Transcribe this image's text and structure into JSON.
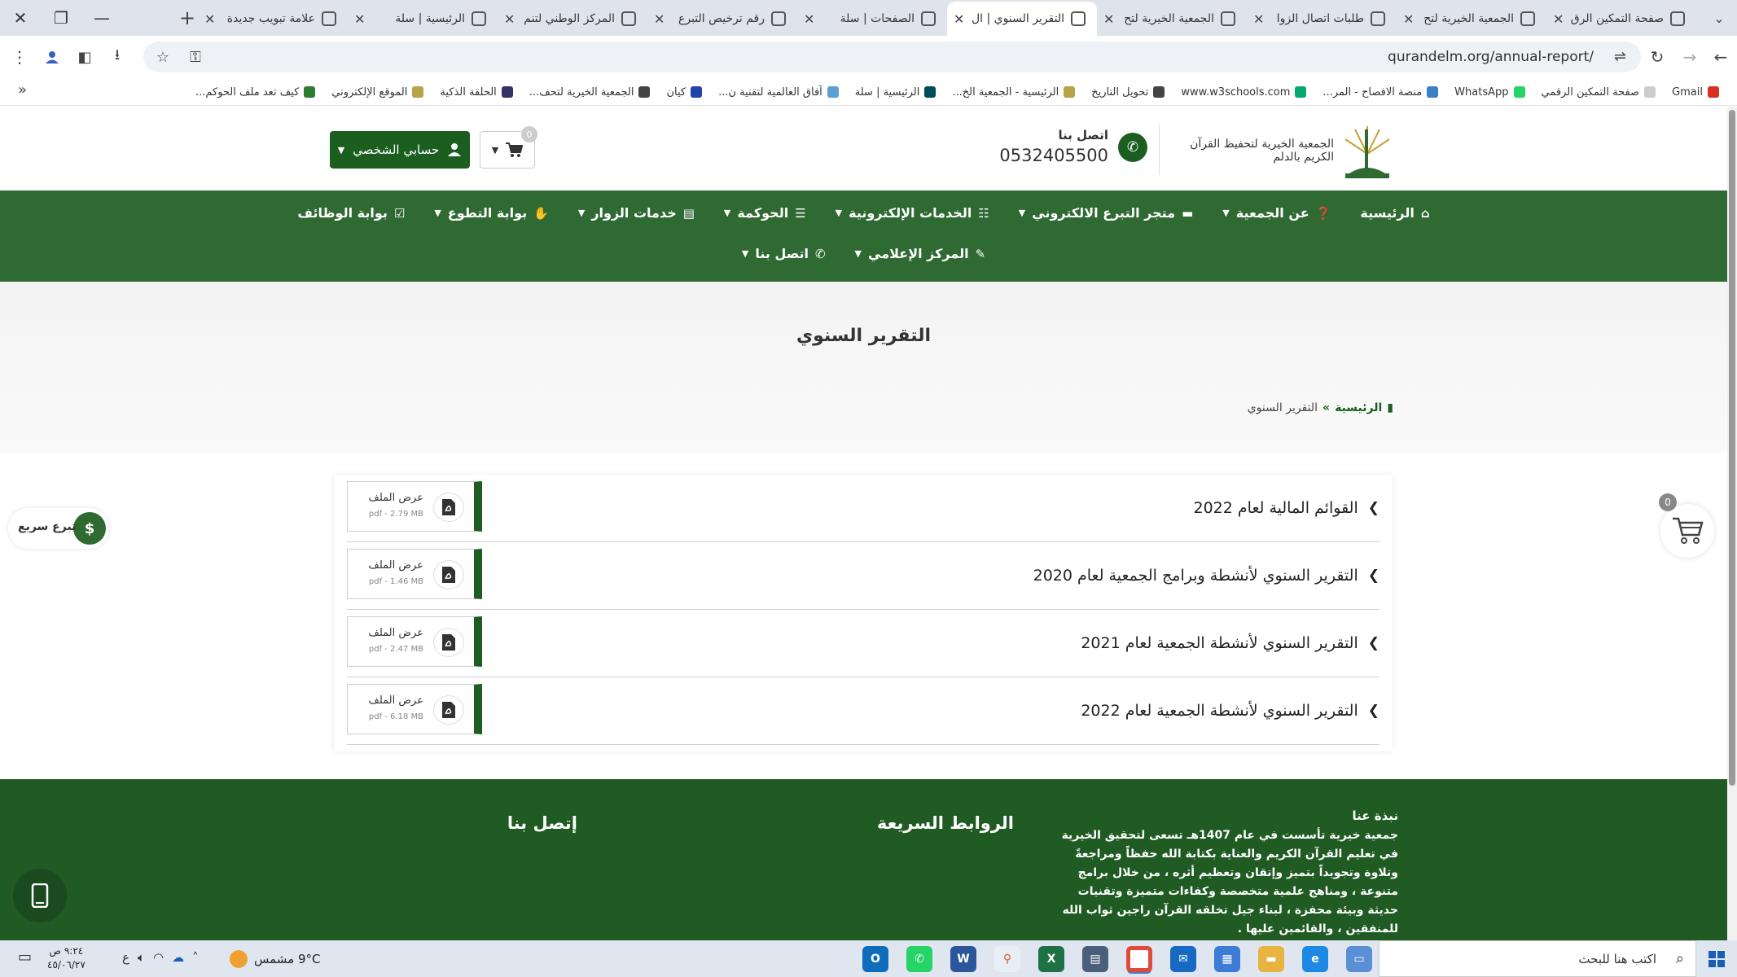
{
  "browser": {
    "tabs": [
      {
        "title": "صفحة التمكين الرق",
        "active": false
      },
      {
        "title": "الجمعية الخيرية لتح",
        "active": false
      },
      {
        "title": "طلبات اتصال الزوا",
        "active": false
      },
      {
        "title": "الجمعية الخيرية لتح",
        "active": false
      },
      {
        "title": "التقرير السنوي | ال",
        "active": true
      },
      {
        "title": "الصفحات | سلة",
        "active": false
      },
      {
        "title": "رقم ترخيص التبرع",
        "active": false
      },
      {
        "title": "المركز الوطني لتنم",
        "active": false
      },
      {
        "title": "الرئيسية | سلة",
        "active": false
      },
      {
        "title": "علامة تبويب جديدة",
        "active": false
      }
    ],
    "url": "qurandelm.org/annual-report/",
    "bookmarks": [
      {
        "label": "Gmail",
        "color": "#d93025"
      },
      {
        "label": "صفحة التمكين الرقمي",
        "color": "#cccccc"
      },
      {
        "label": "WhatsApp",
        "color": "#25d366"
      },
      {
        "label": "منصة الافصاح - المر...",
        "color": "#3b82c4"
      },
      {
        "label": "www.w3schools.com",
        "color": "#04aa6d"
      },
      {
        "label": "تحويل التاريخ",
        "color": "#444444"
      },
      {
        "label": "الرئيسية - الجمعية الخ...",
        "color": "#b8a24a"
      },
      {
        "label": "الرئيسية | سلة",
        "color": "#004d5a"
      },
      {
        "label": "آفاق العالمية لتقنية ن...",
        "color": "#5aa0d8"
      },
      {
        "label": "كيان",
        "color": "#2244aa"
      },
      {
        "label": "الجمعية الخيرية لتحف...",
        "color": "#444444"
      },
      {
        "label": "الحلقة الذكية",
        "color": "#333366"
      },
      {
        "label": "الموقع الإلكتروني",
        "color": "#b8a24a"
      },
      {
        "label": "كيف تعد ملف الحوكم...",
        "color": "#2e7d32"
      }
    ]
  },
  "site": {
    "contact_label": "اتصل بنا",
    "phone": "0532405500",
    "account_label": "حسابي الشخصي",
    "cart_count": "0",
    "logo_text": "الجمعية الخيرية لتحفيظ القرآن الكريم بالدلم",
    "nav_row1": [
      {
        "label": "الرئيسية",
        "icon": "⌂",
        "caret": false,
        "name": "home"
      },
      {
        "label": "عن الجمعية",
        "icon": "❓",
        "caret": true,
        "name": "about"
      },
      {
        "label": "متجر التبرع الالكتروني",
        "icon": "▬",
        "caret": true,
        "name": "donation-store"
      },
      {
        "label": "الخدمات الإلكترونية",
        "icon": "☷",
        "caret": true,
        "name": "e-services"
      },
      {
        "label": "الحوكمة",
        "icon": "☰",
        "caret": true,
        "name": "governance"
      },
      {
        "label": "خدمات الزوار",
        "icon": "▤",
        "caret": true,
        "name": "visitor-services"
      },
      {
        "label": "بوابة التطوع",
        "icon": "✋",
        "caret": true,
        "name": "volunteer-portal"
      },
      {
        "label": "بوابة الوظائف",
        "icon": "☑",
        "caret": false,
        "name": "jobs-portal"
      }
    ],
    "nav_row2": [
      {
        "label": "المركز الإعلامي",
        "icon": "✎",
        "caret": true,
        "name": "media-center"
      },
      {
        "label": "اتصل بنا",
        "icon": "✆",
        "caret": true,
        "name": "contact"
      }
    ],
    "page_title": "التقرير السنوي",
    "breadcrumb": {
      "home": "الرئيسية",
      "sep": "»",
      "current": "التقرير السنوي"
    },
    "reports": [
      {
        "title": "القوائم المالية لعام 2022",
        "file_label": "عرض الملف",
        "meta": "pdf - 2.79 MB"
      },
      {
        "title": "التقرير السنوي لأنشطة وبرامج الجمعية لعام 2020",
        "file_label": "عرض الملف",
        "meta": "pdf - 1.46 MB"
      },
      {
        "title": "التقرير السنوي لأنشطة الجمعية لعام 2021",
        "file_label": "عرض الملف",
        "meta": "pdf - 2.47 MB"
      },
      {
        "title": "التقرير السنوي لأنشطة الجمعية لعام 2022",
        "file_label": "عرض الملف",
        "meta": "pdf - 6.18 MB"
      }
    ],
    "quick_donate": "تبرع سريع",
    "floating_cart_count": "0",
    "footer": {
      "about_title": "نبذة عنا",
      "about_text": "جمعية خيرية تأسست في عام 1407هـ تسعى لتحقيق الخيرية في تعليم القرآن الكريم والعناية بكتابة الله حفظاً ومراجعةً وتلاوة وتجويداً بتميز وإتقان وتعظيم أثره ، من خلال برامج متنوعة ، ومناهج علمية متخصصة وكفاءات متميزة وتقنيات حديثة وبيئة محفزة ، لبناء جيل تخلقه القرآن راجين ثواب الله للمنفقين ، والقائمين عليها .",
      "quick_links": "الروابط السريعة",
      "contact": "إتصل بنا"
    }
  },
  "taskbar": {
    "search_placeholder": "اكتب هنا للبحث",
    "weather": "9°C  مشمس",
    "lang": "ع",
    "time": "٩:٢٤ ص",
    "date": "٤٥/٠٦/٢٧"
  },
  "colors": {
    "brand_green": "#2e6a31",
    "dark_green": "#1b5e20",
    "footer_green": "#1f5b22"
  }
}
